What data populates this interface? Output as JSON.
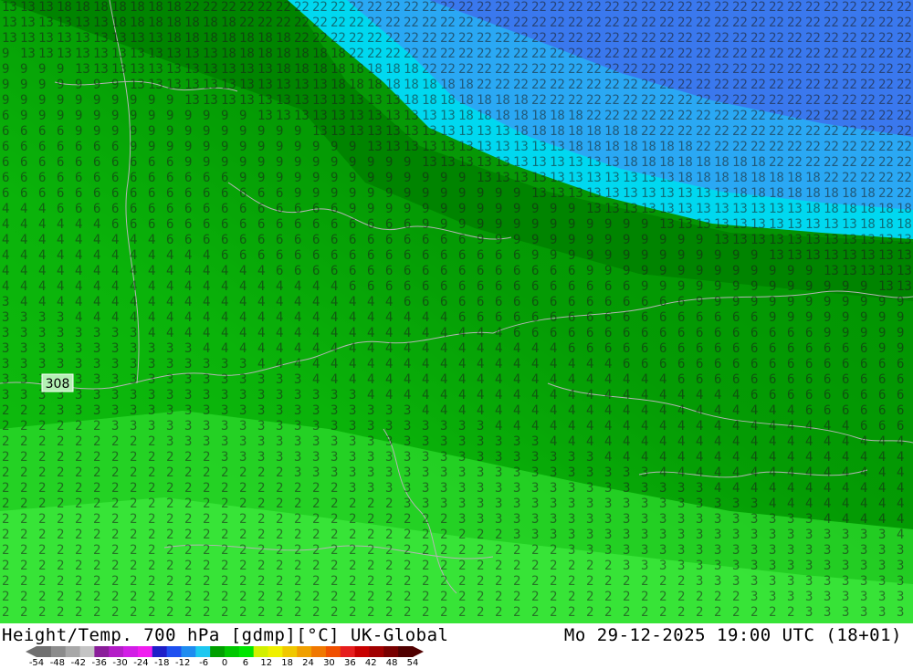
{
  "map": {
    "contour_label": "308",
    "field": "temperature_700hPa",
    "colors": {
      "cold_edge": "#3c6ef0",
      "cool_edge": "#56b8f2",
      "cyan_band": "#00e0ff",
      "green_dark": "#008c00",
      "green_mid": "#00b400",
      "green_light": "#14d214",
      "green_bright": "#3cf03c",
      "border": "#b4b4b4"
    }
  },
  "footer": {
    "title": "Height/Temp. 700 hPa [gdmp][°C] UK-Global",
    "datetime": "Mo 29-12-2025 19:00 UTC (18+01)"
  },
  "colorbar": {
    "tick_labels": [
      "-54",
      "-48",
      "-42",
      "-36",
      "-30",
      "-24",
      "-18",
      "-12",
      "-6",
      "0",
      "6",
      "12",
      "18",
      "24",
      "30",
      "36",
      "42",
      "48",
      "54"
    ],
    "colors": [
      "#707070",
      "#8c8c8c",
      "#a8a8a8",
      "#c4c4c4",
      "#8a1e9a",
      "#b41ec8",
      "#d21ee6",
      "#f01ef0",
      "#1e1ec8",
      "#1e50f0",
      "#1e8cf0",
      "#1ec8f0",
      "#00a000",
      "#00c800",
      "#00e600",
      "#d2f000",
      "#f0f000",
      "#f0c800",
      "#f0a000",
      "#f07800",
      "#f05000",
      "#e61e1e",
      "#c80000",
      "#a00000",
      "#780000",
      "#500000"
    ]
  }
}
